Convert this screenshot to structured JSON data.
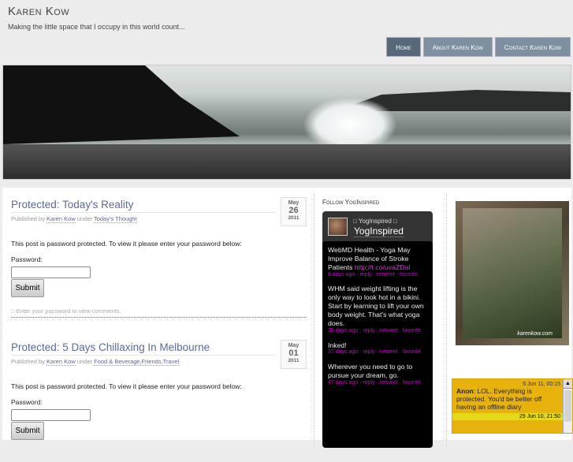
{
  "site": {
    "title": "Karen Kow",
    "tagline": "Making the little space that I occupy in this world count..."
  },
  "nav": [
    {
      "label": "Home"
    },
    {
      "label": "About Karen Kow"
    },
    {
      "label": "Contact Karen Kow"
    }
  ],
  "posts": [
    {
      "title": "Protected: Today's Reality",
      "published_by": "Published by",
      "author": "Karen Kow",
      "under": "under",
      "categories": "Today's Thought",
      "month": "May",
      "day": "26",
      "year": "2011",
      "message": "This post is password protected. To view it please enter your password below:",
      "password_label": "Password:",
      "submit": "Submit",
      "comments": "Enter your password to view comments."
    },
    {
      "title": "Protected: 5 Days Chillaxing In Melbourne",
      "published_by": "Published by",
      "author": "Karen Kow",
      "under": "under",
      "categories": "Food & Beverage,Friends,Travel",
      "month": "May",
      "day": "01",
      "year": "2011",
      "message": "This post is password protected. To view it please enter your password below:",
      "password_label": "Password:",
      "submit": "Submit"
    }
  ],
  "twitter": {
    "widget_title": "Follow YogInspired",
    "user_small": "YogInspired",
    "user": "YogInspired",
    "tweets": [
      {
        "text": "WebMD Health - Yoga May Improve Balance of Stroke Patients ",
        "link": "http://t.co/uvaZDal",
        "actions": "8 days ago · reply · retweet · favorite"
      },
      {
        "text": "WHM said weight lifting is the only way to look hot in a bikini. Start by learning to lift your own body weight. That's what yoga does.",
        "actions": "35 days ago · reply · retweet · favorite"
      },
      {
        "text": "Inked!",
        "actions": "37 days ago · reply · retweet · favorite"
      },
      {
        "text": "Wherever you need to go to pursue your dream, go.",
        "actions": "47 days ago · reply · retweet · favorite"
      }
    ]
  },
  "photo": {
    "watermark": "karenkow.com"
  },
  "shoutbox": {
    "entries": [
      {
        "time": "5 Jun 11, 00:15",
        "name": "Anon",
        "text": ": LOL. Everything is protected. You'd be better off having an offline diary"
      },
      {
        "time": "29 Jun 10, 21:50"
      }
    ]
  }
}
